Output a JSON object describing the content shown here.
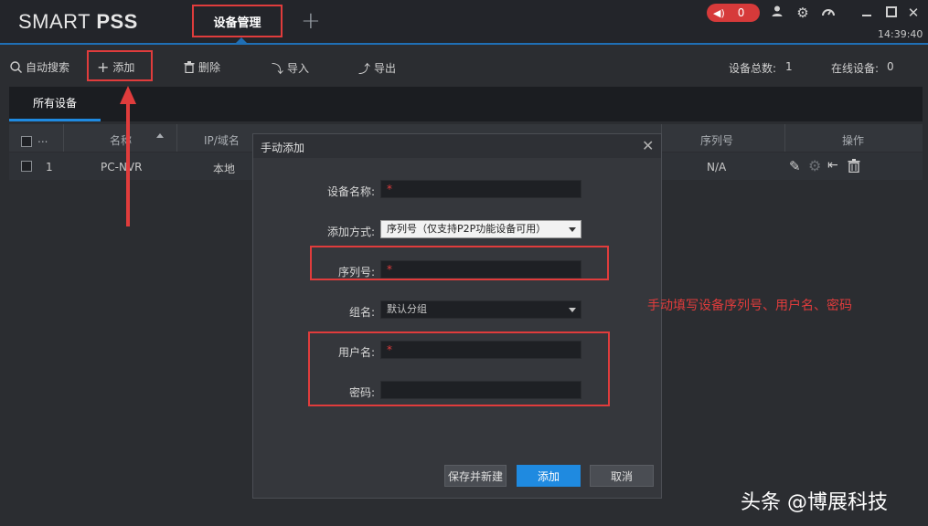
{
  "app": {
    "logo_prefix": "SMART ",
    "logo_bold": "PSS",
    "tab_active": "设备管理",
    "tab_add": "+",
    "alarm_count": "0",
    "clock": "14:39:40"
  },
  "toolbar": {
    "auto_search": "自动搜索",
    "add": "添加",
    "delete": "删除",
    "import": "导入",
    "export": "导出",
    "total_label": "设备总数:",
    "total_value": "1",
    "online_label": "在线设备:",
    "online_value": "0"
  },
  "device_tabs": {
    "all": "所有设备"
  },
  "table": {
    "headers": {
      "more": "...",
      "name": "名称",
      "ip": "IP/域名",
      "serial": "序列号",
      "ops": "操作"
    },
    "rows": [
      {
        "index": "1",
        "name": "PC-NVR",
        "ip": "本地",
        "serial": "N/A"
      }
    ]
  },
  "dialog": {
    "title": "手动添加",
    "close": "✕",
    "fields": {
      "device_name": {
        "label": "设备名称:",
        "required": "*"
      },
      "add_mode": {
        "label": "添加方式:",
        "value": "序列号（仅支持P2P功能设备可用）"
      },
      "serial": {
        "label": "序列号:",
        "required": "*"
      },
      "group": {
        "label": "组名:",
        "value": "默认分组"
      },
      "username": {
        "label": "用户名:",
        "required": "*"
      },
      "password": {
        "label": "密码:"
      }
    },
    "buttons": {
      "save_new": "保存并新建",
      "add": "添加",
      "cancel": "取消"
    }
  },
  "annotation": "手动填写设备序列号、用户名、密码",
  "watermark": "头条 @博展科技",
  "colors": {
    "accent": "#1f8ae0",
    "highlight": "#e03c3c",
    "alarm": "#d63a3a"
  }
}
